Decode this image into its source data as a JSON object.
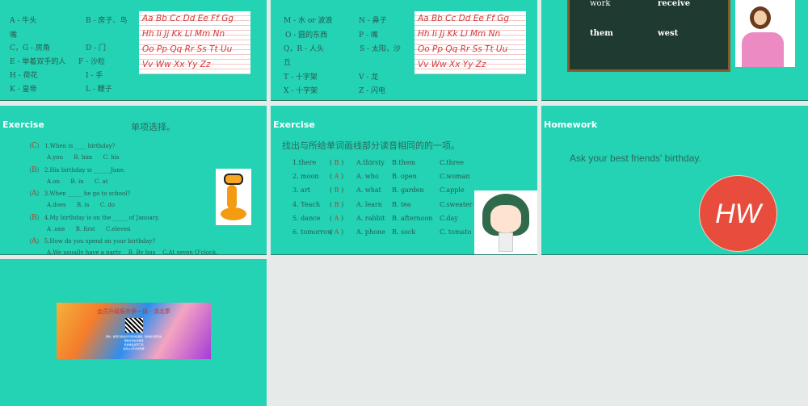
{
  "slide1": {
    "items": [
      "A - 牛头",
      "B - 房子、鸟",
      "嘴",
      "C，G - 房角",
      "D - 门",
      "E - 举着双手的人",
      "F - 沙粒",
      "H - 荷花",
      "I - 手",
      "K - 皇帝",
      "L - 鞭子"
    ],
    "alphabet": [
      "Aa Bb Cc Dd Ee Ff Gg",
      "Hh Ii Jj Kk Ll Mm Nn",
      "Oo Pp Qq Rr Ss Tt Uu",
      "Vv Ww Xx Yy Zz"
    ]
  },
  "slide2": {
    "items": [
      "M - 水 or 波浪",
      "N - 鼻子",
      "O - 圆的东西",
      "P - 嘴",
      "Q，R - 人头",
      "S - 太阳，沙",
      "丘",
      "T - 十字架",
      "V - 龙",
      "X - 十字架",
      "Z - 闪电"
    ]
  },
  "slide3": {
    "words": [
      "work",
      "receive",
      "them",
      "west"
    ]
  },
  "slide4": {
    "title": "Exercise",
    "heading": "单项选择。",
    "questions": [
      {
        "answer": "C",
        "q": "1.When is ____ birthday?",
        "opts": "A.you      B. him      C. his"
      },
      {
        "answer": "B",
        "q": "2.His birthday is ______June.",
        "opts": "A.on      B. in      C. at"
      },
      {
        "answer": "A",
        "q": "3.When _____ he go to school?",
        "opts": "A.does      B. is      C. do"
      },
      {
        "answer": "B",
        "q": "4.My birthday is on the _____ of January.",
        "opts": "A .one      B. first      C.eleven"
      },
      {
        "answer": "A",
        "q": "5.How do you spend on your birthday?",
        "opts": "A.We usually have a party    B. By bus    C.At seven O'clock."
      }
    ]
  },
  "slide5": {
    "title": "Exercise",
    "heading": "找出与所给单词画线部分读音相同的的一项。",
    "rows": [
      {
        "word": "1.there",
        "answer": "B",
        "a": "A.thirsty",
        "b": "B.them",
        "c": "C.three"
      },
      {
        "word": "2. moon",
        "answer": "A",
        "a": "A. who",
        "b": "B. open",
        "c": "C.woman"
      },
      {
        "word": "3. art",
        "answer": "B",
        "a": "A. what",
        "b": "B. garden",
        "c": "C.apple"
      },
      {
        "word": "4. Teach",
        "answer": "B",
        "a": "A. learn",
        "b": "B. tea",
        "c": "C.sweater"
      },
      {
        "word": "5. dance",
        "answer": "A",
        "a": "A. rabbit",
        "b": "B. afternoon",
        "c": "C.day"
      },
      {
        "word": "6. tomorrow",
        "answer": "A",
        "a": "A. phone",
        "b": "B. sock",
        "c": "C. tomato"
      }
    ]
  },
  "slide6": {
    "title": "Homework",
    "text": "Ask your best friends' birthday.",
    "logo": "HW"
  },
  "slide7": {
    "banner_title": "会员升级服务第一拨 · 清北季",
    "banner_lines": [
      "限时，超值升级会员享受特权课程，助你提分更高效",
      "课堂名师在线答疑",
      "最新精品资源下载",
      "会员app专享优惠券"
    ]
  }
}
